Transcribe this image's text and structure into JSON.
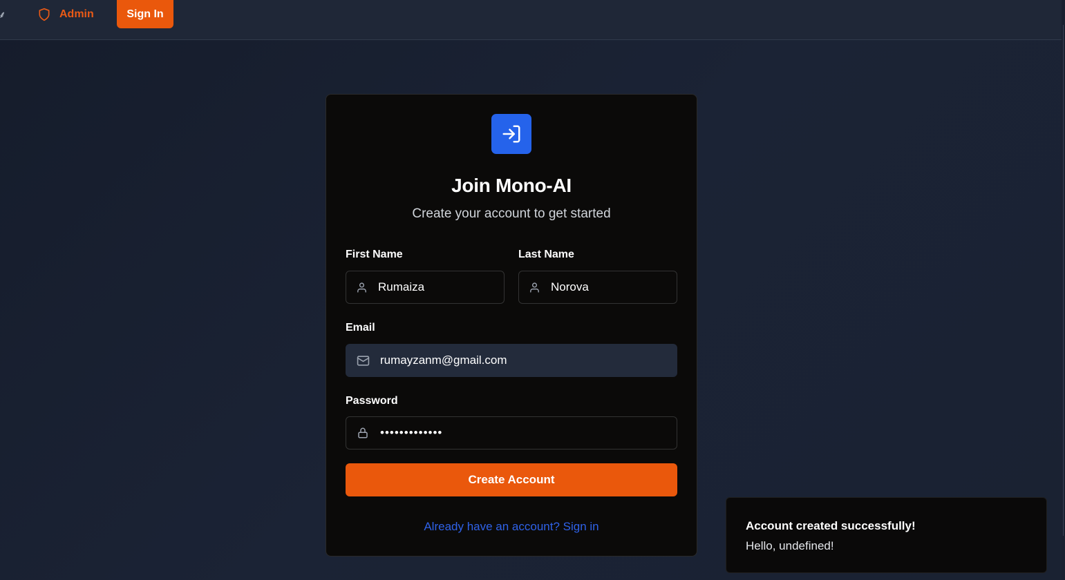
{
  "nav": {
    "edge_glyph": "ࠉ",
    "admin_label": "Admin",
    "signin_label": "Sign In"
  },
  "card": {
    "title": "Join Mono-AI",
    "subtitle": "Create your account to get started",
    "first_name": {
      "label": "First Name",
      "value": "Rumaiza"
    },
    "last_name": {
      "label": "Last Name",
      "value": "Norova"
    },
    "email": {
      "label": "Email",
      "value": "rumayzanm@gmail.com"
    },
    "password": {
      "label": "Password",
      "value": "rumayzanm1234"
    },
    "submit_label": "Create Account",
    "signin_link": "Already have an account? Sign in"
  },
  "toast": {
    "title": "Account created successfully!",
    "description": "Hello, undefined!"
  },
  "colors": {
    "accent": "#ea580c",
    "brand_blue": "#2563eb",
    "link": "#2f62e8",
    "background": "#1b2335"
  },
  "icons": {
    "admin": "shield-icon",
    "logo": "log-in-icon",
    "first_name": "user-icon",
    "last_name": "user-icon",
    "email": "mail-icon",
    "password": "lock-icon"
  }
}
